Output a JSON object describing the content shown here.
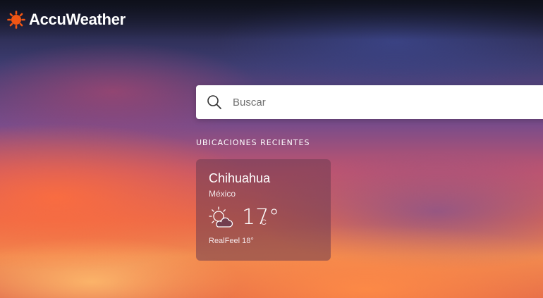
{
  "brand": {
    "name": "AccuWeather",
    "accent": "#f05514"
  },
  "search": {
    "placeholder": "Buscar"
  },
  "recent": {
    "title": "UBICACIONES RECIENTES",
    "locations": [
      {
        "city": "Chihuahua",
        "country": "México",
        "temperature": "17°",
        "unit": "C",
        "realfeel": "RealFeel 18°",
        "icon": "sun-behind-cloud-icon"
      }
    ]
  }
}
